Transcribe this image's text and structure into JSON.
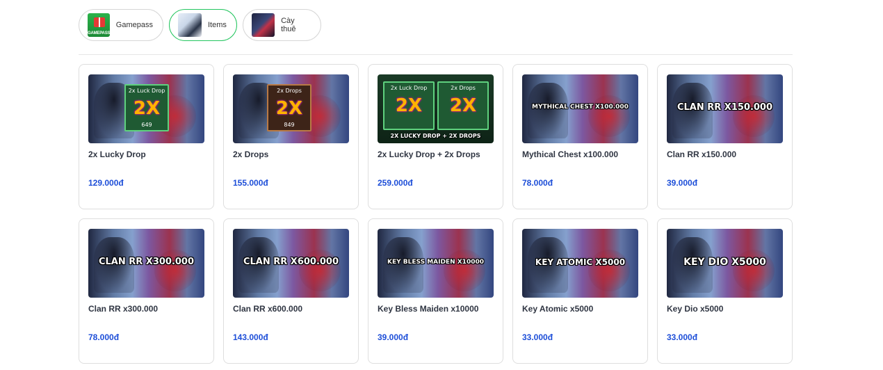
{
  "tabs": [
    {
      "label": "Gamepass",
      "thumb_text": "GAMEPASS"
    },
    {
      "label": "Items"
    },
    {
      "label": "Cày thuê"
    }
  ],
  "products": [
    {
      "title": "2x Lucky Drop",
      "price": "129.000đ",
      "badge_title": "2x Luck Drop",
      "badge_big": "2X",
      "badge_price": "649"
    },
    {
      "title": "2x Drops",
      "price": "155.000đ",
      "badge_title": "2x Drops",
      "badge_big": "2X",
      "badge_price": "849"
    },
    {
      "title": "2x Lucky Drop + 2x Drops",
      "price": "259.000đ",
      "badge_a": "2x Luck Drop",
      "badge_b": "2x Drops",
      "badge_big": "2X",
      "caption": "2X LUCKY DROP + 2X DROPS"
    },
    {
      "title": "Mythical Chest x100.000",
      "price": "78.000đ",
      "overlay": "MYTHICAL CHEST X100.000"
    },
    {
      "title": "Clan RR x150.000",
      "price": "39.000đ",
      "overlay": "CLAN RR X150.000"
    },
    {
      "title": "Clan RR x300.000",
      "price": "78.000đ",
      "overlay": "CLAN RR X300.000"
    },
    {
      "title": "Clan RR x600.000",
      "price": "143.000đ",
      "overlay": "CLAN RR X600.000"
    },
    {
      "title": "Key Bless Maiden x10000",
      "price": "39.000đ",
      "overlay": "KEY BLESS MAIDEN X10000"
    },
    {
      "title": "Key Atomic x5000",
      "price": "33.000đ",
      "overlay": "KEY ATOMIC X5000"
    },
    {
      "title": "Key Dio x5000",
      "price": "33.000đ",
      "overlay": "KEY DIO X5000"
    }
  ]
}
